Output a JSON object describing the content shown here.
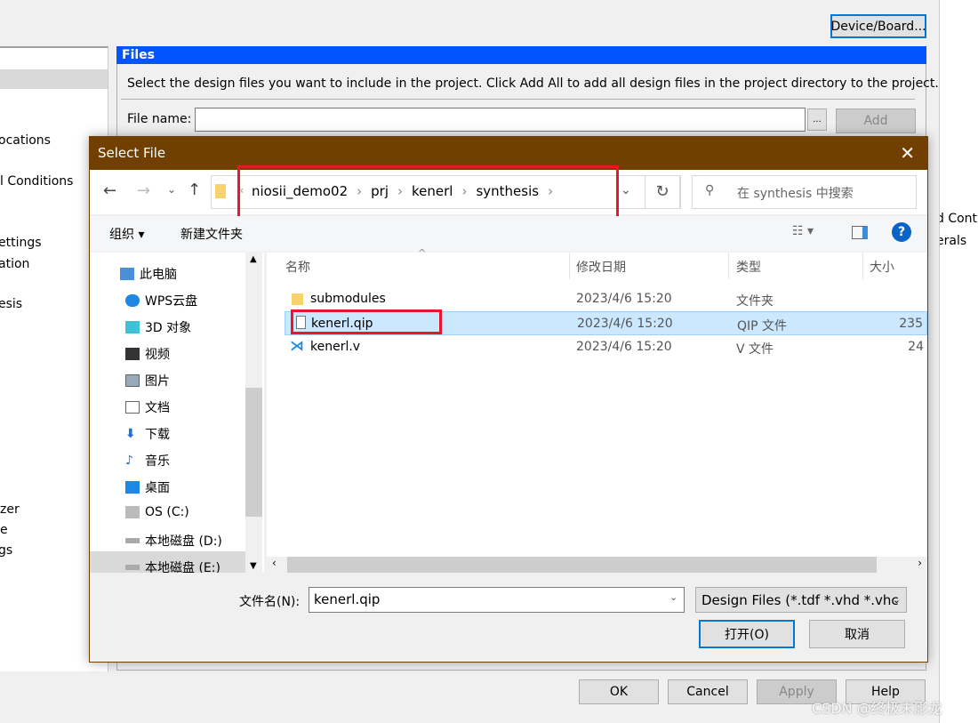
{
  "background": {
    "device_button": "Device/Board...",
    "left_items": [
      "ocations",
      "l Conditions",
      "ettings",
      "ation",
      "esis",
      "zer",
      "e",
      "gs"
    ],
    "right_items": [
      "d Contr",
      "erals"
    ],
    "files_header": "Files",
    "instruction": "Select the design files you want to include in the project. Click Add All to add all design files in the project directory to the project.",
    "file_name_label": "File name:",
    "file_name_value": "",
    "browse_button": "...",
    "add_button": "Add",
    "ok_button": "OK",
    "cancel_button": "Cancel",
    "apply_button": "Apply",
    "help_button": "Help"
  },
  "dialog": {
    "title": "Select File",
    "breadcrumb": [
      "niosii_demo02",
      "prj",
      "kenerl",
      "synthesis"
    ],
    "search_placeholder": "在 synthesis 中搜索",
    "toolbar": {
      "organize": "组织",
      "new_folder": "新建文件夹"
    },
    "nav": [
      "此电脑",
      "WPS云盘",
      "3D 对象",
      "视频",
      "图片",
      "文档",
      "下载",
      "音乐",
      "桌面",
      "OS (C:)",
      "本地磁盘 (D:)",
      "本地磁盘 (E:)"
    ],
    "columns": [
      "名称",
      "修改日期",
      "类型",
      "大小"
    ],
    "files": [
      {
        "name": "submodules",
        "date": "2023/4/6 15:20",
        "type": "文件夹",
        "size": "",
        "icon": "folder-icon"
      },
      {
        "name": "kenerl.qip",
        "date": "2023/4/6 15:20",
        "type": "QIP 文件",
        "size": "235",
        "icon": "file-icon",
        "selected": true
      },
      {
        "name": "kenerl.v",
        "date": "2023/4/6 15:20",
        "type": "V 文件",
        "size": "24",
        "icon": "vscode-icon"
      }
    ],
    "filename_label": "文件名(N):",
    "filename_value": "kenerl.qip",
    "filter": "Design Files (*.tdf *.vhd *.vhc",
    "open_button": "打开(O)",
    "cancel_button": "取消"
  },
  "watermark": "CSDN @终极末影龙",
  "colors": {
    "title_bar": "#714000",
    "files_header": "#0055ff",
    "highlight": "#e8182a",
    "selection": "#cce8ff"
  }
}
